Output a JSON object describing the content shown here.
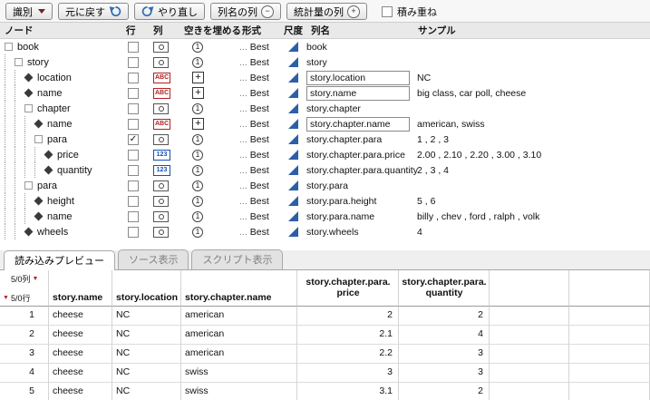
{
  "toolbar": {
    "identify": "識別",
    "undo": "元に戻す",
    "redo": "やり直し",
    "colname_col": "列名の列",
    "stats_col": "統計量の列",
    "stack": "積み重ね",
    "minus_icon": "−",
    "plus_icon": "+"
  },
  "tree": {
    "headers": {
      "node": "ノード",
      "row": "行",
      "col": "列",
      "fill": "空きを埋める",
      "format": "形式",
      "scale": "尺度",
      "colname": "列名",
      "sample": "サンプル"
    },
    "format_prefix": "...",
    "format_label": "Best",
    "icons": {
      "abc": "ABC",
      "num": "123",
      "one": "1",
      "plus": "+"
    },
    "rows": [
      {
        "label": "book",
        "indent": 0,
        "kind": "container",
        "checked": false,
        "col_icon": "media",
        "fill_icon": "one",
        "colname": "book",
        "input": false,
        "sample": ""
      },
      {
        "label": "story",
        "indent": 1,
        "kind": "container",
        "checked": false,
        "col_icon": "media",
        "fill_icon": "one",
        "colname": "story",
        "input": false,
        "sample": ""
      },
      {
        "label": "location",
        "indent": 2,
        "kind": "leaf",
        "checked": false,
        "col_icon": "abc",
        "fill_icon": "plus",
        "colname": "story.location",
        "input": true,
        "sample": "NC"
      },
      {
        "label": "name",
        "indent": 2,
        "kind": "leaf",
        "checked": false,
        "col_icon": "abc",
        "fill_icon": "plus",
        "colname": "story.name",
        "input": true,
        "sample": "big class, car poll, cheese"
      },
      {
        "label": "chapter",
        "indent": 2,
        "kind": "container",
        "checked": false,
        "col_icon": "media",
        "fill_icon": "one",
        "colname": "story.chapter",
        "input": false,
        "sample": ""
      },
      {
        "label": "name",
        "indent": 3,
        "kind": "leaf",
        "checked": false,
        "col_icon": "abc",
        "fill_icon": "plus",
        "colname": "story.chapter.name",
        "input": true,
        "sample": "american, swiss"
      },
      {
        "label": "para",
        "indent": 3,
        "kind": "container",
        "checked": true,
        "col_icon": "media",
        "fill_icon": "one",
        "colname": "story.chapter.para",
        "input": false,
        "sample": "1 , 2 , 3"
      },
      {
        "label": "price",
        "indent": 4,
        "kind": "leaf",
        "checked": false,
        "col_icon": "num",
        "fill_icon": "one",
        "colname": "story.chapter.para.price",
        "input": false,
        "sample": "2.00 , 2.10 , 2.20 , 3.00 , 3.10"
      },
      {
        "label": "quantity",
        "indent": 4,
        "kind": "leaf",
        "checked": false,
        "col_icon": "num",
        "fill_icon": "one",
        "colname": "story.chapter.para.quantity",
        "input": false,
        "sample": "2 , 3 , 4"
      },
      {
        "label": "para",
        "indent": 2,
        "kind": "container",
        "checked": false,
        "col_icon": "media",
        "fill_icon": "one",
        "colname": "story.para",
        "input": false,
        "sample": ""
      },
      {
        "label": "height",
        "indent": 3,
        "kind": "leaf",
        "checked": false,
        "col_icon": "media",
        "fill_icon": "one",
        "colname": "story.para.height",
        "input": false,
        "sample": "5 , 6"
      },
      {
        "label": "name",
        "indent": 3,
        "kind": "leaf",
        "checked": false,
        "col_icon": "media",
        "fill_icon": "one",
        "colname": "story.para.name",
        "input": false,
        "sample": "billy , chev , ford , ralph , volk"
      },
      {
        "label": "wheels",
        "indent": 2,
        "kind": "leaf",
        "checked": false,
        "col_icon": "media",
        "fill_icon": "one",
        "colname": "story.wheels",
        "input": false,
        "sample": "4"
      }
    ]
  },
  "tabs": [
    {
      "label": "読み込みプレビュー",
      "active": true
    },
    {
      "label": "ソース表示",
      "active": false
    },
    {
      "label": "スクリプト表示",
      "active": false
    }
  ],
  "preview": {
    "corner": {
      "cols": "5/0列",
      "rows": "5/0行",
      "tri": "▼"
    },
    "header_lines": [
      [
        "story.name"
      ],
      [
        "story.location"
      ],
      [
        "story.chapter.name"
      ],
      [
        "story.chapter.para.",
        "price"
      ],
      [
        "story.chapter.para.",
        "quantity"
      ]
    ],
    "rows": [
      {
        "n": "1",
        "cells": [
          "cheese",
          "NC",
          "american",
          "2",
          "2"
        ]
      },
      {
        "n": "2",
        "cells": [
          "cheese",
          "NC",
          "american",
          "2.1",
          "4"
        ]
      },
      {
        "n": "3",
        "cells": [
          "cheese",
          "NC",
          "american",
          "2.2",
          "3"
        ]
      },
      {
        "n": "4",
        "cells": [
          "cheese",
          "NC",
          "swiss",
          "3",
          "3"
        ]
      },
      {
        "n": "5",
        "cells": [
          "cheese",
          "NC",
          "swiss",
          "3.1",
          "2"
        ]
      }
    ]
  }
}
